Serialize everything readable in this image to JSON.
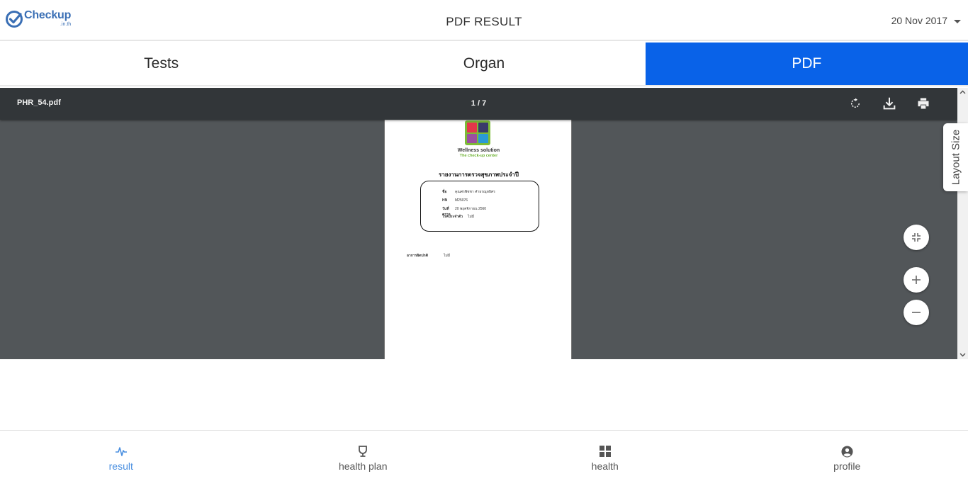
{
  "header": {
    "logo_brand": "Checkup",
    "logo_sub": ".in.th",
    "title": "PDF RESULT",
    "date": "20 Nov 2017"
  },
  "tabs": [
    {
      "label": "Tests",
      "active": false
    },
    {
      "label": "Organ",
      "active": false
    },
    {
      "label": "PDF",
      "active": true
    }
  ],
  "pdf_viewer": {
    "file_name": "PHR_54.pdf",
    "page_indicator": "1 / 7",
    "toolbar_icons": [
      "rotate-icon",
      "download-icon",
      "print-icon"
    ],
    "layout_size_label": "Layout Size",
    "controls": [
      "fit-page-icon",
      "zoom-in-icon",
      "zoom-out-icon"
    ]
  },
  "pdf_page": {
    "company_name": "Wellness solution",
    "company_tagline": "The check-up center",
    "report_title": "รายงานการตรวจสุขภาพประจำปี",
    "info": [
      {
        "key": "ชื่อ",
        "value": "คุณศรพิชชา คำธรณุทธิศร"
      },
      {
        "key": "HN",
        "value": "M25076"
      },
      {
        "key": "วันที่ตรวจ",
        "value": "20 พฤศจิกายน 2560"
      },
      {
        "key": "โรคประจำตัว",
        "value": "ไม่มี"
      }
    ],
    "abnormal_label": "อาการผิดปกติ",
    "abnormal_value": "ไม่มี"
  },
  "bottom_nav": [
    {
      "label": "result",
      "icon": "pulse-icon",
      "active": true
    },
    {
      "label": "health plan",
      "icon": "trophy-icon",
      "active": false
    },
    {
      "label": "health",
      "icon": "grid-icon",
      "active": false
    },
    {
      "label": "profile",
      "icon": "account-circle-icon",
      "active": false
    }
  ],
  "colors": {
    "accent": "#0962e8",
    "nav_active": "#4a8fe0",
    "viewer_bg": "#525659",
    "toolbar_bg": "#323639"
  }
}
